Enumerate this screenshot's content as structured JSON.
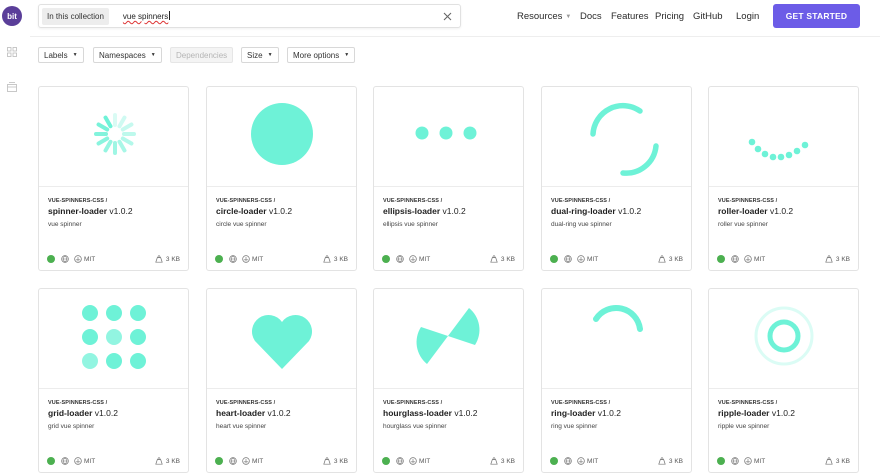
{
  "brand": {
    "logo": "bit",
    "accent": "#6c5ce7",
    "spinner_color": "#6ef2d7"
  },
  "search": {
    "scope": "In this collection",
    "value": "vue spinners"
  },
  "nav": {
    "resources": "Resources",
    "docs": "Docs",
    "features": "Features",
    "pricing": "Pricing",
    "github": "GitHub",
    "login": "Login",
    "cta": "GET STARTED"
  },
  "filters": [
    {
      "label": "Labels",
      "enabled": true
    },
    {
      "label": "Namespaces",
      "enabled": true
    },
    {
      "label": "Dependencies",
      "enabled": false
    },
    {
      "label": "Size",
      "enabled": true
    },
    {
      "label": "More options",
      "enabled": true
    }
  ],
  "cards": [
    {
      "scope": "VUE-SPINNERS-CSS /",
      "name": "spinner-loader",
      "version": "v1.0.2",
      "desc": "vue spinner",
      "license": "MIT",
      "size": "3 KB",
      "preview": "spinner-lines"
    },
    {
      "scope": "VUE-SPINNERS-CSS /",
      "name": "circle-loader",
      "version": "v1.0.2",
      "desc": "circle vue spinner",
      "license": "MIT",
      "size": "3 KB",
      "preview": "circle"
    },
    {
      "scope": "VUE-SPINNERS-CSS /",
      "name": "ellipsis-loader",
      "version": "v1.0.2",
      "desc": "ellipsis vue spinner",
      "license": "MIT",
      "size": "3 KB",
      "preview": "ellipsis"
    },
    {
      "scope": "VUE-SPINNERS-CSS /",
      "name": "dual-ring-loader",
      "version": "v1.0.2",
      "desc": "dual-ring vue spinner",
      "license": "MIT",
      "size": "3 KB",
      "preview": "dual-ring"
    },
    {
      "scope": "VUE-SPINNERS-CSS /",
      "name": "roller-loader",
      "version": "v1.0.2",
      "desc": "roller vue spinner",
      "license": "MIT",
      "size": "3 KB",
      "preview": "roller"
    },
    {
      "scope": "VUE-SPINNERS-CSS /",
      "name": "grid-loader",
      "version": "v1.0.2",
      "desc": "grid vue spinner",
      "license": "MIT",
      "size": "3 KB",
      "preview": "grid"
    },
    {
      "scope": "VUE-SPINNERS-CSS /",
      "name": "heart-loader",
      "version": "v1.0.2",
      "desc": "heart vue spinner",
      "license": "MIT",
      "size": "3 KB",
      "preview": "heart"
    },
    {
      "scope": "VUE-SPINNERS-CSS /",
      "name": "hourglass-loader",
      "version": "v1.0.2",
      "desc": "hourglass vue spinner",
      "license": "MIT",
      "size": "3 KB",
      "preview": "hourglass"
    },
    {
      "scope": "VUE-SPINNERS-CSS /",
      "name": "ring-loader",
      "version": "v1.0.2",
      "desc": "ring vue spinner",
      "license": "MIT",
      "size": "3 KB",
      "preview": "ring"
    },
    {
      "scope": "VUE-SPINNERS-CSS /",
      "name": "ripple-loader",
      "version": "v1.0.2",
      "desc": "ripple vue spinner",
      "license": "MIT",
      "size": "3 KB",
      "preview": "ripple"
    }
  ]
}
